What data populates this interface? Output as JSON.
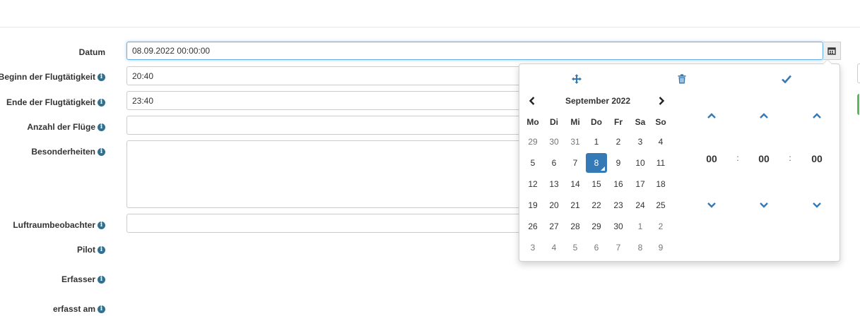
{
  "form": {
    "datum_label": "Datum",
    "datum_value": "08.09.2022 00:00:00",
    "beginn_label": "Beginn der Flugtätigkeit",
    "beginn_value": "20:40",
    "ende_label": "Ende der Flugtätigkeit",
    "ende_value": "23:40",
    "anzahl_label": "Anzahl der Flüge",
    "anzahl_value": "",
    "besonderheiten_label": "Besonderheiten",
    "besonderheiten_value": "",
    "luftraum_label": "Luftraumbeobachter",
    "luftraum_value": "",
    "pilot_label": "Pilot",
    "erfasser_label": "Erfasser",
    "erfasst_label": "erfasst am",
    "info_glyph": "i"
  },
  "picker": {
    "tools": [
      "move-icon",
      "trash-icon",
      "check-icon"
    ],
    "month_title": "September 2022",
    "weekdays": [
      "Mo",
      "Di",
      "Mi",
      "Do",
      "Fr",
      "Sa",
      "So"
    ],
    "weeks": [
      [
        "29",
        "30",
        "31",
        "1",
        "2",
        "3",
        "4"
      ],
      [
        "5",
        "6",
        "7",
        "8",
        "9",
        "10",
        "11"
      ],
      [
        "12",
        "13",
        "14",
        "15",
        "16",
        "17",
        "18"
      ],
      [
        "19",
        "20",
        "21",
        "22",
        "23",
        "24",
        "25"
      ],
      [
        "26",
        "27",
        "28",
        "29",
        "30",
        "1",
        "2"
      ],
      [
        "3",
        "4",
        "5",
        "6",
        "7",
        "8",
        "9"
      ]
    ],
    "hours": "00",
    "minutes": "00",
    "seconds": "00",
    "separator": ":",
    "accent_color": "#337ab7"
  }
}
